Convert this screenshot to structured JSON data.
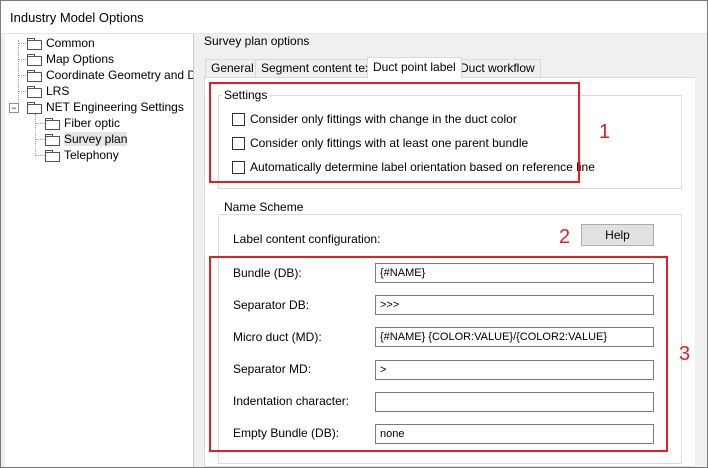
{
  "window": {
    "title": "Industry Model Options"
  },
  "tree": {
    "items": [
      {
        "label": "Common"
      },
      {
        "label": "Map Options"
      },
      {
        "label": "Coordinate Geometry and Dimensioning"
      },
      {
        "label": "LRS"
      },
      {
        "label": "NET Engineering Settings",
        "expander": "−"
      },
      {
        "label": "Fiber optic"
      },
      {
        "label": "Survey plan"
      },
      {
        "label": "Telephony"
      }
    ]
  },
  "panel": {
    "title": "Survey plan options",
    "tabs": [
      "General",
      "Segment content text",
      "Duct point label",
      "Duct workflow"
    ]
  },
  "settings": {
    "legend": "Settings",
    "checkboxes": [
      "Consider only fittings with change in the duct color",
      "Consider only fittings with at least one parent bundle",
      "Automatically determine label orientation based on reference line"
    ]
  },
  "name_scheme": {
    "legend": "Name Scheme",
    "config_label": "Label content configuration:",
    "help_label": "Help",
    "fields": [
      {
        "label": "Bundle (DB):",
        "value": "{#NAME}"
      },
      {
        "label": "Separator DB:",
        "value": ">>>"
      },
      {
        "label": "Micro duct (MD):",
        "value": "{#NAME} {COLOR:VALUE}/{COLOR2:VALUE}"
      },
      {
        "label": "Separator MD:",
        "value": ">"
      },
      {
        "label": "Indentation character:",
        "value": ""
      },
      {
        "label": "Empty Bundle (DB):",
        "value": "none"
      }
    ]
  },
  "annotations": {
    "one": "1",
    "two": "2",
    "three": "3"
  },
  "colors": {
    "highlight": "#e41e24",
    "window_bg": "#f0f0f0"
  }
}
